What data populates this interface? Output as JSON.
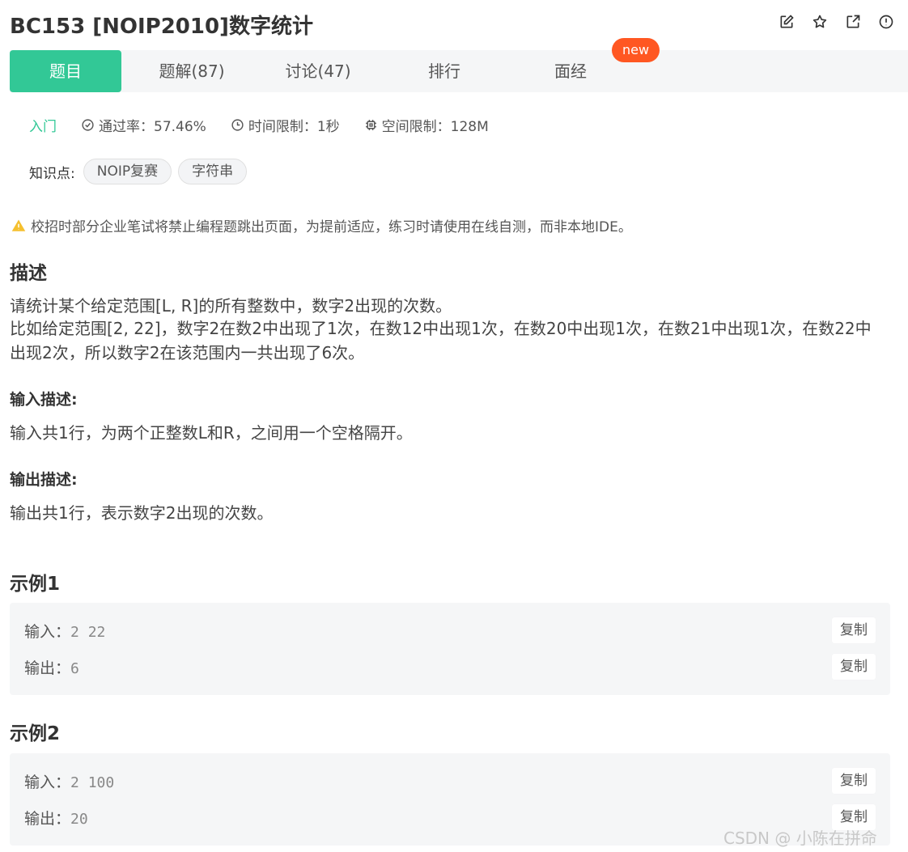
{
  "header": {
    "title": "BC153  [NOIP2010]数字统计",
    "icons": [
      "edit-icon",
      "star-icon",
      "share-icon",
      "report-icon"
    ]
  },
  "tabs": [
    {
      "label": "题目",
      "active": true
    },
    {
      "label": "题解(87)"
    },
    {
      "label": "讨论(47)"
    },
    {
      "label": "排行"
    },
    {
      "label": "面经"
    }
  ],
  "new_badge": "new",
  "meta": {
    "level": "入门",
    "pass_rate": "通过率：57.46%",
    "time_limit": "时间限制：1秒",
    "space_limit": "空间限制：128M"
  },
  "knowledge": {
    "label": "知识点:",
    "tags": [
      "NOIP复赛",
      "字符串"
    ]
  },
  "warning": "校招时部分企业笔试将禁止编程题跳出页面，为提前适应，练习时请使用在线自测，而非本地IDE。",
  "description": {
    "title": "描述",
    "line1": "请统计某个给定范围[L, R]的所有整数中，数字2出现的次数。",
    "line2": "比如给定范围[2, 22]，数字2在数2中出现了1次，在数12中出现1次，在数20中出现1次，在数21中出现1次，在数22中",
    "line3": "出现2次，所以数字2在该范围内一共出现了6次。"
  },
  "input_desc": {
    "title": "输入描述:",
    "text": "输入共1行，为两个正整数L和R，之间用一个空格隔开。"
  },
  "output_desc": {
    "title": "输出描述:",
    "text": "输出共1行，表示数字2出现的次数。"
  },
  "examples": [
    {
      "title": "示例1",
      "input_label": "输入：",
      "input": "2 22",
      "output_label": "输出：",
      "output": "6",
      "copy": "复制"
    },
    {
      "title": "示例2",
      "input_label": "输入：",
      "input": "2 100",
      "output_label": "输出：",
      "output": "20",
      "copy": "复制"
    }
  ],
  "watermark": "CSDN @  小陈在拼命",
  "colors": {
    "accent": "#32c896",
    "badge": "#ff5722",
    "warning": "#f5c02f"
  }
}
